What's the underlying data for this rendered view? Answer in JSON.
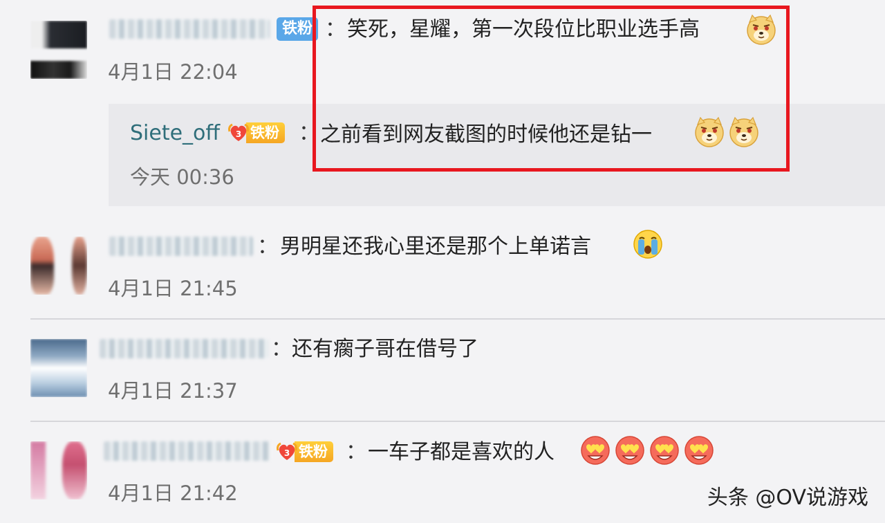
{
  "comments": [
    {
      "badge": "铁粉",
      "text": "笑死，星耀，第一次段位比职业选手高",
      "time": "4月1日 22:04",
      "reply": {
        "username": "Siete_off",
        "badge": "铁粉",
        "text": "之前看到网友截图的时候他还是钻一",
        "time": "今天 00:36"
      }
    },
    {
      "text": "男明星还我心里还是那个上单诺言",
      "time": "4月1日 21:45"
    },
    {
      "text": "还有瘸子哥在借号了",
      "time": "4月1日 21:37"
    },
    {
      "badge": "铁粉",
      "text": "一车子都是喜欢的人",
      "time": "4月1日 21:42"
    }
  ],
  "colon": "：",
  "watermark": "头条 @OV说游戏",
  "icons": {
    "doge": "doge-emoji-icon",
    "crying": "crying-emoji-icon",
    "heart_eyes": "heart-eyes-emoji-icon",
    "fan_badge": "heart-fan-badge-icon"
  },
  "colors": {
    "highlight": "#e8171f",
    "reply_username": "#2f6e7a",
    "badge_blue": "#5aa7e8",
    "badge_gold": "#f5a623"
  }
}
